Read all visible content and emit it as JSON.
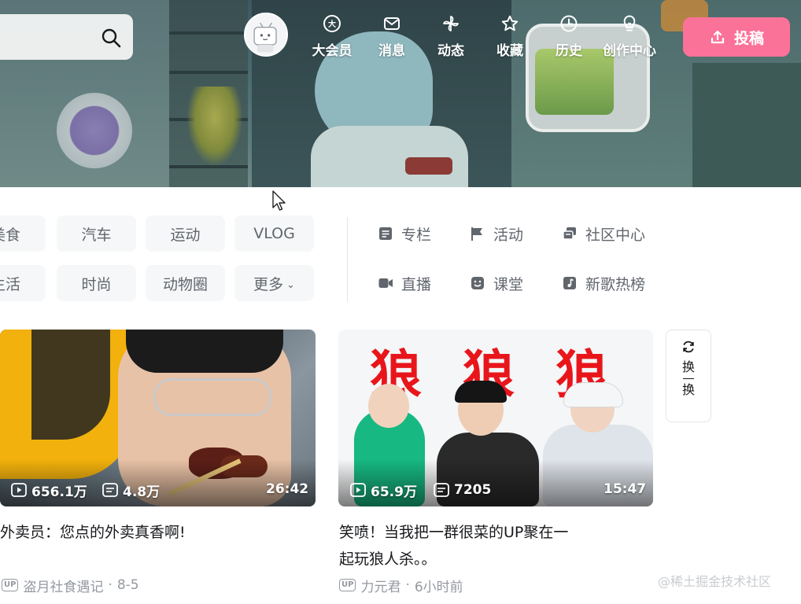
{
  "header": {
    "search": {
      "placeholder": ""
    },
    "nav": [
      {
        "label": "大会员",
        "icon": "vip-icon"
      },
      {
        "label": "消息",
        "icon": "message-icon"
      },
      {
        "label": "动态",
        "icon": "windmill-icon"
      },
      {
        "label": "收藏",
        "icon": "star-icon"
      },
      {
        "label": "历史",
        "icon": "clock-icon"
      },
      {
        "label": "创作中心",
        "icon": "bulb-icon"
      }
    ],
    "upload_label": "投稿"
  },
  "channels": {
    "row1": [
      "美食",
      "汽车",
      "运动",
      "VLOG"
    ],
    "row2": [
      "生活",
      "时尚",
      "动物圈",
      "更多"
    ],
    "links": [
      {
        "label": "专栏",
        "icon": "article-icon"
      },
      {
        "label": "活动",
        "icon": "flag-icon"
      },
      {
        "label": "社区中心",
        "icon": "community-icon"
      },
      {
        "label": "直播",
        "icon": "live-icon"
      },
      {
        "label": "课堂",
        "icon": "classroom-icon"
      },
      {
        "label": "新歌热榜",
        "icon": "music-icon"
      }
    ]
  },
  "videos": [
    {
      "views": "656.1万",
      "comments": "4.8万",
      "duration": "26:42",
      "title": "外卖员：您点的外卖真香啊!",
      "up_badge": "UP",
      "author": "盗月社食遇记",
      "date": "8-5"
    },
    {
      "thumb_text": [
        "狼",
        "狼",
        "狼"
      ],
      "views": "65.9万",
      "comments": "7205",
      "duration": "15:47",
      "title_line1": "笑喷！当我把一群很菜的UP聚在一",
      "title_line2": "起玩狼人杀。。",
      "up_badge": "UP",
      "author": "力元君",
      "date": "6小时前"
    }
  ],
  "refresh": {
    "char1": "换",
    "char2": "换"
  },
  "watermark": "@稀土掘金技术社区",
  "colors": {
    "accent": "#fb7299",
    "text": "#18191c",
    "muted": "#61666d",
    "chip_bg": "#f6f7f8"
  }
}
